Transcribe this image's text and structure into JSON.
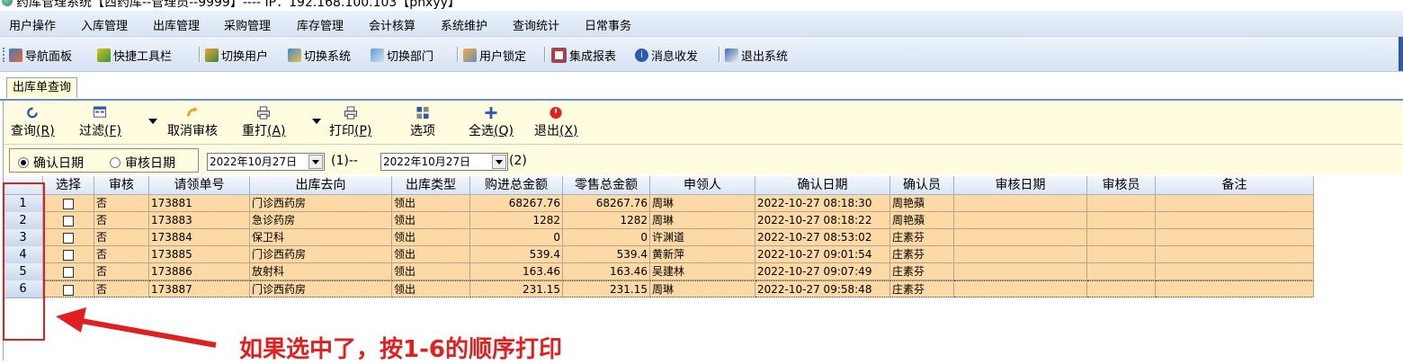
{
  "window": {
    "title": "药库管理系统【西药库--管理员--9999】---- IP：192.168.100.103【phxyy】"
  },
  "menu": [
    "用户操作",
    "入库管理",
    "出库管理",
    "采购管理",
    "库存管理",
    "会计核算",
    "系统维护",
    "查询统计",
    "日常事务"
  ],
  "toolbar": {
    "nav": "导航面板",
    "quick": "快捷工具栏",
    "switch_user": "切换用户",
    "switch_system": "切换系统",
    "switch_dept": "切换部门",
    "lock": "用户锁定",
    "report": "集成报表",
    "msg": "消息收发",
    "exit": "退出系统"
  },
  "tab": {
    "label": "出库单查询"
  },
  "actions": {
    "query": {
      "label": "查询",
      "key": "(R)"
    },
    "filter": {
      "label": "过滤",
      "key": "(F)"
    },
    "cancel_audit": {
      "label": "取消审核"
    },
    "reprint": {
      "label": "重打",
      "key": "(A)"
    },
    "print": {
      "label": "打印",
      "key": "(P)"
    },
    "options": {
      "label": "选项"
    },
    "select_all": {
      "label": "全选",
      "key": "(Q)"
    },
    "exit": {
      "label": "退出",
      "key": "(X)"
    }
  },
  "filter": {
    "radio_confirm": "确认日期",
    "radio_audit": "审核日期",
    "radio_selected": "确认日期",
    "date_from": "2022年10月27日",
    "sep1": "(1)--",
    "date_to": "2022年10月27日",
    "sep2": "(2)"
  },
  "table": {
    "columns": [
      "选择",
      "审核",
      "请领单号",
      "出库去向",
      "出库类型",
      "购进总金额",
      "零售总金额",
      "申领人",
      "确认日期",
      "确认员",
      "审核日期",
      "审核员",
      "备注"
    ],
    "rows": [
      {
        "n": "1",
        "audit": "否",
        "no": "173881",
        "dest": "门诊西药房",
        "type": "领出",
        "buy": "68267.76",
        "retail": "68267.76",
        "applicant": "周琳",
        "date": "2022-10-27 08:18:30",
        "confirmer": "周艳蘋"
      },
      {
        "n": "2",
        "audit": "否",
        "no": "173883",
        "dest": "急诊药房",
        "type": "领出",
        "buy": "1282",
        "retail": "1282",
        "applicant": "周琳",
        "date": "2022-10-27 08:18:22",
        "confirmer": "周艳蘋"
      },
      {
        "n": "3",
        "audit": "否",
        "no": "173884",
        "dest": "保卫科",
        "type": "领出",
        "buy": "0",
        "retail": "0",
        "applicant": "许渊道",
        "date": "2022-10-27 08:53:02",
        "confirmer": "庄素芬"
      },
      {
        "n": "4",
        "audit": "否",
        "no": "173885",
        "dest": "门诊西药房",
        "type": "领出",
        "buy": "539.4",
        "retail": "539.4",
        "applicant": "黄新萍",
        "date": "2022-10-27 09:01:54",
        "confirmer": "庄素芬"
      },
      {
        "n": "5",
        "audit": "否",
        "no": "173886",
        "dest": "放射科",
        "type": "领出",
        "buy": "163.46",
        "retail": "163.46",
        "applicant": "吴建林",
        "date": "2022-10-27 09:07:49",
        "confirmer": "庄素芬"
      },
      {
        "n": "6",
        "audit": "否",
        "no": "173887",
        "dest": "门诊西药房",
        "type": "领出",
        "buy": "231.15",
        "retail": "231.15",
        "applicant": "周琳",
        "date": "2022-10-27 09:58:48",
        "confirmer": "庄素芬"
      }
    ]
  },
  "annotation": {
    "text": "如果选中了，按1-6的顺序打印",
    "color": "#e02020"
  }
}
